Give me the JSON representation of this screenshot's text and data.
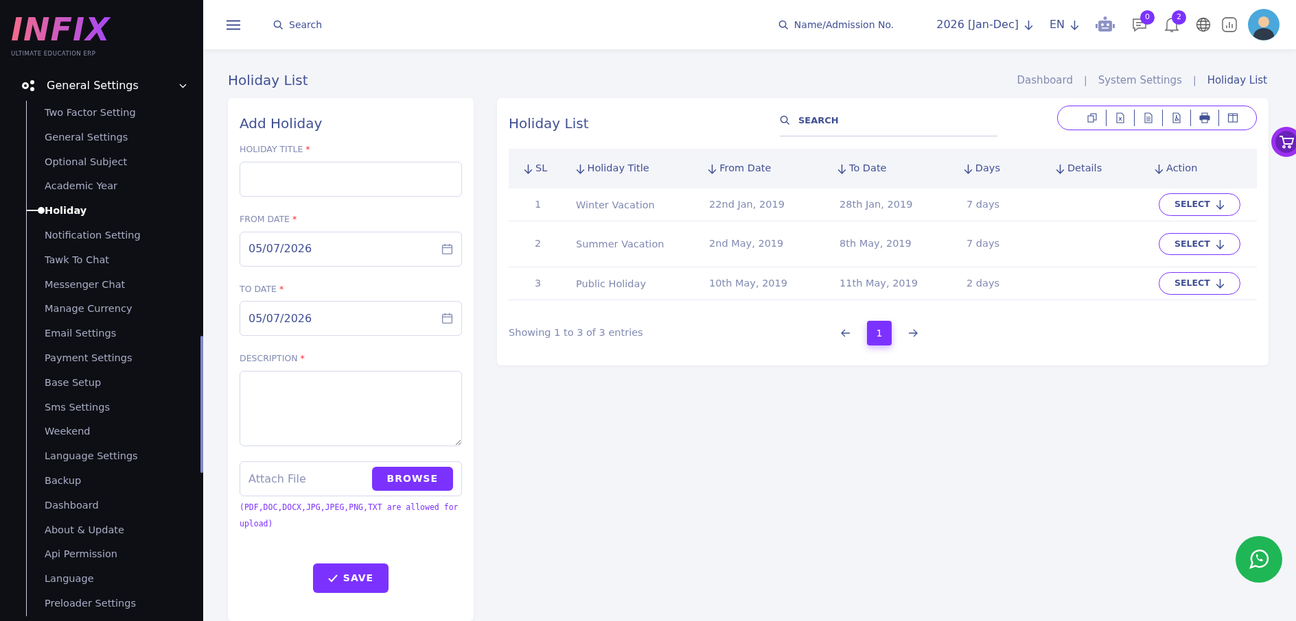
{
  "logo": {
    "title": "INFIX",
    "subtitle": "ULTIMATE EDUCATION ERP"
  },
  "sidebar": {
    "group": {
      "label": "General Settings",
      "expanded": true
    },
    "items": [
      {
        "label": "Two Factor Setting",
        "selected": false
      },
      {
        "label": "General Settings",
        "selected": false
      },
      {
        "label": "Optional Subject",
        "selected": false
      },
      {
        "label": "Academic Year",
        "selected": false
      },
      {
        "label": "Holiday",
        "selected": true
      },
      {
        "label": "Notification Setting",
        "selected": false
      },
      {
        "label": "Tawk To Chat",
        "selected": false
      },
      {
        "label": "Messenger Chat",
        "selected": false
      },
      {
        "label": "Manage Currency",
        "selected": false
      },
      {
        "label": "Email Settings",
        "selected": false
      },
      {
        "label": "Payment Settings",
        "selected": false
      },
      {
        "label": "Base Setup",
        "selected": false
      },
      {
        "label": "Sms Settings",
        "selected": false
      },
      {
        "label": "Weekend",
        "selected": false
      },
      {
        "label": "Language Settings",
        "selected": false
      },
      {
        "label": "Backup",
        "selected": false
      },
      {
        "label": "Dashboard",
        "selected": false
      },
      {
        "label": "About & Update",
        "selected": false
      },
      {
        "label": "Api Permission",
        "selected": false
      },
      {
        "label": "Language",
        "selected": false
      },
      {
        "label": "Preloader Settings",
        "selected": false
      }
    ]
  },
  "topbar": {
    "search_placeholder": "Search",
    "student_search_placeholder": "Name/Admission No.",
    "session": "2026 [Jan-Dec]",
    "language": "EN",
    "messages_count": "0",
    "notifications_count": "2"
  },
  "page": {
    "title": "Holiday List",
    "breadcrumbs": [
      {
        "label": "Dashboard",
        "selected": false
      },
      {
        "separator": "|",
        "label": "System Settings",
        "selected": false
      },
      {
        "separator": "|",
        "label": "Holiday List",
        "selected": true
      }
    ]
  },
  "form": {
    "title": "Add Holiday",
    "fields": [
      {
        "kind": "text",
        "label": "HOLIDAY TITLE",
        "required_mark": "*"
      },
      {
        "kind": "date",
        "label": "FROM DATE",
        "required_mark": "*",
        "value": "05/07/2026"
      },
      {
        "kind": "date",
        "label": "TO DATE",
        "required_mark": "*",
        "value": "05/07/2026"
      },
      {
        "kind": "textarea",
        "label": "DESCRIPTION",
        "required_mark": "*"
      }
    ],
    "attach": {
      "placeholder": "Attach File",
      "button": "BROWSE"
    },
    "hint": "(PDF,DOC,DOCX,JPG,JPEG,PNG,TXT are allowed for upload)",
    "save": "SAVE"
  },
  "table": {
    "title": "Holiday List",
    "search_placeholder": "SEARCH",
    "columns": [
      "SL",
      "Holiday Title",
      "From Date",
      "To Date",
      "Days",
      "Details",
      "Action"
    ],
    "rows": [
      {
        "sl": "1",
        "title": "Winter Vacation",
        "from": "22nd Jan, 2019",
        "to": "28th Jan, 2019",
        "days": "7 days",
        "action": "SELECT"
      },
      {
        "sl": "2",
        "title": "Summer Vacation",
        "from": "2nd May, 2019",
        "to": "8th May, 2019",
        "days": "7 days",
        "action": "SELECT"
      },
      {
        "sl": "3",
        "title": "Public Holiday",
        "from": "10th May, 2019",
        "to": "11th May, 2019",
        "days": "2 days",
        "action": "SELECT"
      }
    ],
    "info": "Showing 1 to 3 of 3 entries",
    "pages": [
      {
        "label": "1",
        "selected": true
      }
    ]
  }
}
